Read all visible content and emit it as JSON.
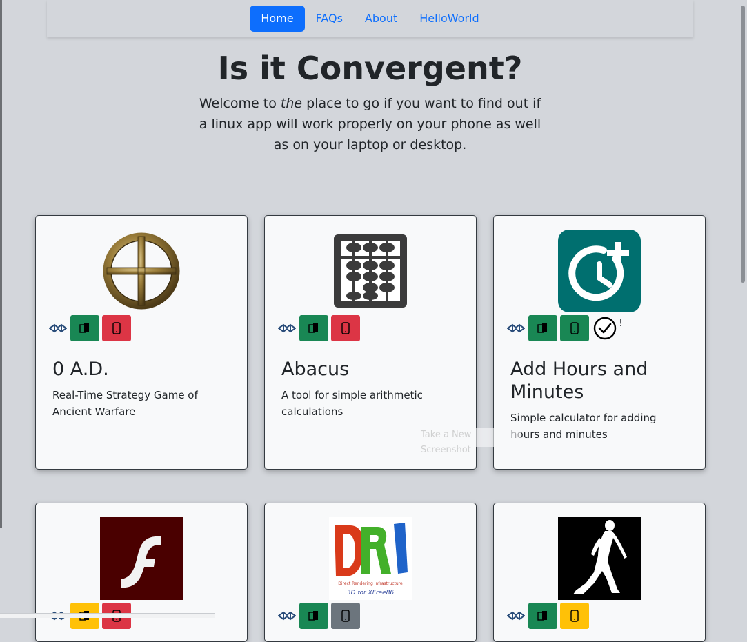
{
  "nav": {
    "items": [
      {
        "label": "Home",
        "active": true
      },
      {
        "label": "FAQs",
        "active": false
      },
      {
        "label": "About",
        "active": false
      },
      {
        "label": "HelloWorld",
        "active": false
      }
    ]
  },
  "hero": {
    "title": "Is it Convergent?",
    "intro_before": "Welcome to ",
    "intro_emphasis": "the",
    "intro_after": " place to go if you want to find out if a linux app will work properly on your phone as well as on your laptop or desktop."
  },
  "cards": [
    {
      "title": "0 A.D.",
      "description": "Real-Time Strategy Game of Ancient Warfare",
      "icon": "zero-ad-logo-icon",
      "badges": [
        "green",
        "red"
      ]
    },
    {
      "title": "Abacus",
      "description": "A tool for simple arithmetic calculations",
      "icon": "abacus-icon",
      "badges": [
        "green",
        "red"
      ]
    },
    {
      "title": "Add Hours and Minutes",
      "description": "Simple calculator for adding hours and minutes",
      "icon": "clock-plus-icon",
      "badges": [
        "green",
        "green"
      ],
      "check_suffix": "!"
    },
    {
      "title": "",
      "description": "",
      "icon": "flash-icon",
      "badges": [
        "yellow",
        "red"
      ]
    },
    {
      "title": "",
      "description": "",
      "icon": "dri-logo-icon",
      "badges": [
        "green",
        "gray"
      ]
    },
    {
      "title": "",
      "description": "",
      "icon": "walking-figure-icon",
      "badges": [
        "green",
        "yellow"
      ]
    }
  ],
  "tooltip": {
    "text": "Take a New Screenshot"
  },
  "colors": {
    "primary": "#0d6efd",
    "success": "#198754",
    "danger": "#dc3545",
    "warning": "#ffc107",
    "secondary": "#6c757d",
    "page_bg": "#d3d6db"
  }
}
